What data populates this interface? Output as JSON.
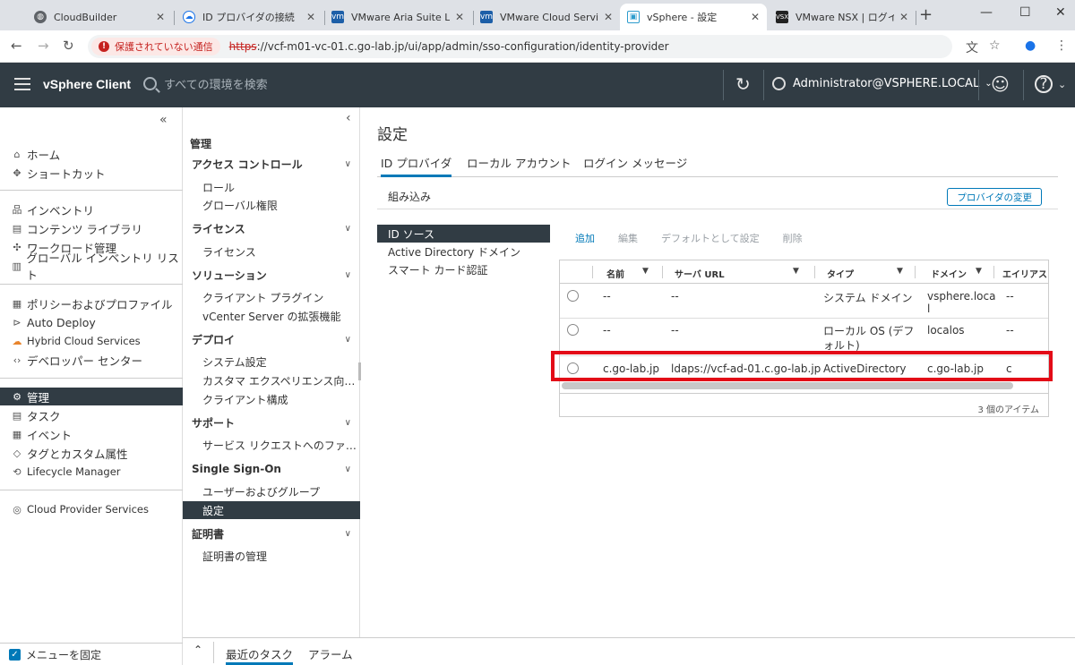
{
  "browser": {
    "tabs": [
      {
        "title": "CloudBuilder",
        "favicon": "globe-icon"
      },
      {
        "title": "ID プロバイダの接続",
        "favicon": "cloud-icon"
      },
      {
        "title": "VMware Aria Suite Lifecycl",
        "favicon": "vmware-icon"
      },
      {
        "title": "VMware Cloud Services",
        "favicon": "vmware-icon"
      },
      {
        "title": "vSphere - 設定",
        "favicon": "vsphere-icon",
        "active": true
      },
      {
        "title": "VMware NSX | ログイン",
        "favicon": "nsx-icon"
      }
    ],
    "security_label": "保護されていない通信",
    "url_scheme": "https",
    "url_rest": "://vcf-m01-vc-01.c.go-lab.jp/ui/app/admin/sso-configuration/identity-provider"
  },
  "header": {
    "brand": "vSphere Client",
    "search_placeholder": "すべての環境を検索",
    "user": "Administrator@VSPHERE.LOCAL"
  },
  "leftnav": {
    "items": [
      {
        "label": "ホーム",
        "icon": "home-icon"
      },
      {
        "label": "ショートカット",
        "icon": "shortcut-icon"
      },
      {
        "label": "インベントリ",
        "icon": "inventory-icon"
      },
      {
        "label": "コンテンツ ライブラリ",
        "icon": "library-icon"
      },
      {
        "label": "ワークロード管理",
        "icon": "workload-icon"
      },
      {
        "label": "グローバル インベントリ リスト",
        "icon": "global-list-icon"
      },
      {
        "label": "ポリシーおよびプロファイル",
        "icon": "policy-icon"
      },
      {
        "label": "Auto Deploy",
        "icon": "auto-deploy-icon"
      },
      {
        "label": "Hybrid Cloud Services",
        "icon": "hybrid-cloud-icon"
      },
      {
        "label": "デベロッパー センター",
        "icon": "code-icon"
      },
      {
        "label": "管理",
        "icon": "admin-icon",
        "selected": true
      },
      {
        "label": "タスク",
        "icon": "tasks-icon"
      },
      {
        "label": "イベント",
        "icon": "events-icon"
      },
      {
        "label": "タグとカスタム属性",
        "icon": "tag-icon"
      },
      {
        "label": "Lifecycle Manager",
        "icon": "lifecycle-icon"
      },
      {
        "label": "Cloud Provider Services",
        "icon": "cloud-provider-icon"
      }
    ],
    "pin_label": "メニューを固定"
  },
  "adminnav": {
    "heading": "管理",
    "sections": [
      {
        "label": "アクセス コントロール",
        "items": [
          "ロール",
          "グローバル権限"
        ]
      },
      {
        "label": "ライセンス",
        "items": [
          "ライセンス"
        ]
      },
      {
        "label": "ソリューション",
        "items": [
          "クライアント プラグイン",
          "vCenter Server の拡張機能"
        ]
      },
      {
        "label": "デプロイ",
        "items": [
          "システム設定",
          "カスタマ エクスペリエンス向…",
          "クライアント構成"
        ]
      },
      {
        "label": "サポート",
        "items": [
          "サービス リクエストへのファ…"
        ]
      },
      {
        "label": "Single Sign-On",
        "items": [
          "ユーザーおよびグループ",
          "設定"
        ]
      },
      {
        "label": "証明書",
        "items": [
          "証明書の管理"
        ]
      }
    ]
  },
  "main": {
    "title": "設定",
    "tabs": [
      "ID プロバイダ",
      "ローカル アカウント",
      "ログイン メッセージ"
    ],
    "builtin_label": "組み込み",
    "change_provider_button": "プロバイダの変更",
    "subnav": [
      "ID ソース",
      "Active Directory ドメイン",
      "スマート カード認証"
    ],
    "actions": {
      "add": "追加",
      "edit": "編集",
      "set_default": "デフォルトとして設定",
      "delete": "削除"
    },
    "grid": {
      "columns": [
        "名前",
        "サーバ URL",
        "タイプ",
        "ドメイン",
        "エイリアス"
      ],
      "rows": [
        {
          "name": "--",
          "url": "--",
          "type": "システム ドメイン",
          "domain": "vsphere.loca\nl",
          "alias": "--"
        },
        {
          "name": "--",
          "url": "--",
          "type": "ローカル OS (デフ\nォルト)",
          "domain": "localos",
          "alias": "--"
        },
        {
          "name": "c.go-lab.jp",
          "url": "ldaps://vcf-ad-01.c.go-lab.jp",
          "type": "ActiveDirectory",
          "domain": "c.go-lab.jp",
          "alias": "c"
        }
      ],
      "footer": "3 個のアイテム"
    },
    "highlight_color": "#e30b17"
  },
  "bottombar": {
    "recent_tasks": "最近のタスク",
    "alarms": "アラーム"
  }
}
